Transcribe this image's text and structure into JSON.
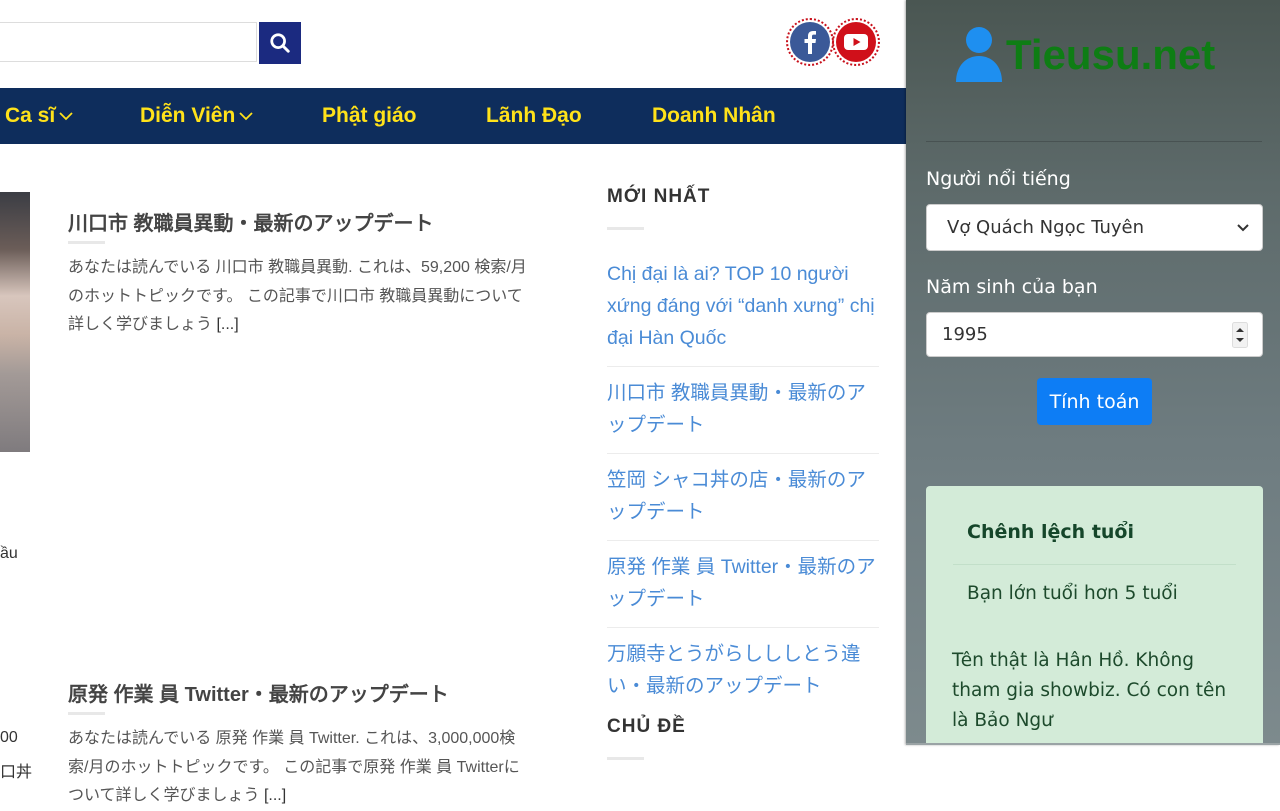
{
  "header": {
    "search_placeholder": "",
    "social": [
      "facebook-icon",
      "youtube-icon"
    ]
  },
  "nav": {
    "items": [
      {
        "label": "Ca sĩ",
        "has_dropdown": true
      },
      {
        "label": "Diễn Viên",
        "has_dropdown": true
      },
      {
        "label": "Phật giáo",
        "has_dropdown": false
      },
      {
        "label": "Lãnh Đạo",
        "has_dropdown": false
      },
      {
        "label": "Doanh Nhân",
        "has_dropdown": false
      }
    ]
  },
  "posts": [
    {
      "title": "川口市 教職員異動・最新のアップデート",
      "excerpt": "あなたは読んでいる 川口市 教職員異動. これは、59,200 検索/月のホットトピックです。 この記事で川口市 教職員異動について詳しく学びましょう ",
      "more": "[...]"
    },
    {
      "title": "原発 作業 員 Twitter・最新のアップデート",
      "excerpt": "あなたは読んでいる 原発 作業 員 Twitter. これは、3,000,000検索/月のホットトピックです。 この記事で原発 作業 員 Twitterについて詳しく学びましょう ",
      "more": "[...]"
    }
  ],
  "fragments": [
    "ầu",
    "00",
    "口丼"
  ],
  "sidebar": {
    "recent_title": "MỚI NHẤT",
    "recent": [
      "Chị đại là ai? TOP 10 người xứng đáng với “danh xưng” chị đại Hàn Quốc",
      "川口市 教職員異動・最新のアップデート",
      "笠岡 シャコ丼の店・最新のアップデート",
      "原発 作業 員 Twitter・最新のアップデート",
      "万願寺とうがらしししとう違い・最新のアップデート"
    ],
    "topics_title": "CHỦ ĐỀ"
  },
  "panel": {
    "logo_text": "Tieusu.net",
    "celebrity_label": "Người nổi tiếng",
    "celebrity_value": "Vợ Quách Ngọc Tuyên",
    "birth_year_label": "Năm sinh của bạn",
    "birth_year_value": "1995",
    "calc_button": "Tính toán",
    "result_title": "Chênh lệch tuổi",
    "result_text": "Bạn lớn tuổi hơn 5 tuổi",
    "result_note": "Tên thật là Hân Hồ. Không tham gia showbiz. Có con tên là Bảo Ngư"
  },
  "colors": {
    "nav_bg": "#0e2d5c",
    "nav_text": "#ffe21a",
    "link": "#4a8bd6",
    "button": "#0d7df5",
    "result_bg": "#d3ebd8",
    "logo": "#0e7d14"
  }
}
